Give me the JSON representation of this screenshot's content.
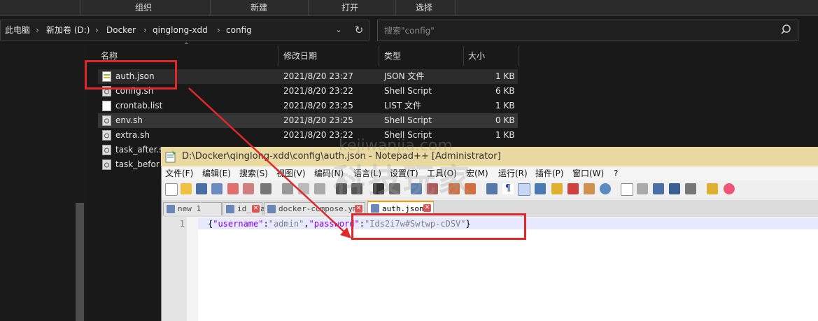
{
  "explorer": {
    "ribbon": [
      "组织",
      "新建",
      "打开",
      "选择"
    ],
    "breadcrumb": [
      "此电脑",
      "新加卷 (D:)",
      "Docker",
      "qinglong-xdd",
      "config"
    ],
    "breadcrumb_separator": "›",
    "search_placeholder": "搜索\"config\"",
    "columns": {
      "name": "名称",
      "date": "修改日期",
      "type": "类型",
      "size": "大小"
    },
    "files": [
      {
        "name": "auth.json",
        "date": "2021/8/20 23:27",
        "type": "JSON 文件",
        "size": "1 KB"
      },
      {
        "name": "config.sh",
        "date": "2021/8/20 23:22",
        "type": "Shell Script",
        "size": "6 KB"
      },
      {
        "name": "crontab.list",
        "date": "2021/8/20 23:25",
        "type": "LIST 文件",
        "size": "1 KB"
      },
      {
        "name": "env.sh",
        "date": "2021/8/20 23:25",
        "type": "Shell Script",
        "size": "0 KB"
      },
      {
        "name": "extra.sh",
        "date": "2021/8/20 23:22",
        "type": "Shell Script",
        "size": "1 KB"
      },
      {
        "name": "task_after.s",
        "date": "",
        "type": "",
        "size": ""
      },
      {
        "name": "task_befor",
        "date": "",
        "type": "",
        "size": ""
      }
    ]
  },
  "notepad": {
    "title": "D:\\Docker\\qinglong-xdd\\config\\auth.json - Notepad++ [Administrator]",
    "menu": [
      "文件(F)",
      "编辑(E)",
      "搜索(S)",
      "视图(V)",
      "编码(N)",
      "语言(L)",
      "设置(T)",
      "工具(O)",
      "宏(M)",
      "运行(R)",
      "插件(P)",
      "窗口(W)",
      "?"
    ],
    "tabs": [
      "new 1",
      "id_rsa",
      "docker-compose.yml",
      "auth.json"
    ],
    "line_number": "1",
    "code": {
      "open": "{",
      "key1": "\"username\"",
      "colon1": ":",
      "val1": "\"admin\"",
      "comma": ",",
      "key2": "\"password\"",
      "colon2": ":",
      "val2": "\"Ids2i7w#Swtwp-cDSV\"",
      "close": "}"
    }
  },
  "watermark": {
    "url": "kejiwanjia.com",
    "text": "科技玩家"
  },
  "colors": {
    "annotation": "#e0282a",
    "json_key": "#8000ff",
    "json_value": "#808080"
  }
}
